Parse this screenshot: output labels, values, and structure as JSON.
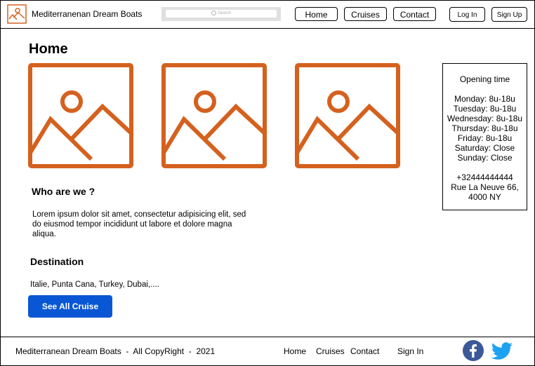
{
  "brand": {
    "name": "Mediterranenan Dream Boats"
  },
  "search": {
    "placeholder": "Search"
  },
  "nav": {
    "home": "Home",
    "cruises": "Cruises",
    "contact": "Contact"
  },
  "auth": {
    "login": "Log In",
    "signup": "Sign Up"
  },
  "page": {
    "title": "Home"
  },
  "about": {
    "heading": "Who are we ?",
    "text": "Lorem ipsum dolor sit amet, consectetur adipisicing elit, sed do eiusmod tempor incididunt ut labore et dolore magna aliqua."
  },
  "destination": {
    "heading": "Destination",
    "text": "Italie, Punta Cana, Turkey, Dubai,....",
    "button": "See All Cruise"
  },
  "hours": {
    "title": "Opening time",
    "lines": [
      "Monday: 8u-18u",
      "Tuesday: 8u-18u",
      "Wednesday: 8u-18u",
      "Thursday: 8u-18u",
      "Friday: 8u-18u",
      "Saturday: Close",
      "Sunday: Close"
    ],
    "phone": "+32444444444",
    "address1": "Rue La Neuve 66,",
    "address2": "4000 NY"
  },
  "footer": {
    "copyright": "Mediterranean Dream Boats  -  All CopyRight  -  2021",
    "home": "Home",
    "cruises": "Cruises",
    "contact": "Contact",
    "signin": "Sign In"
  },
  "colors": {
    "accent": "#d4611e",
    "button": "#0957d4",
    "facebook": "#3b5998",
    "twitter": "#1da1f2"
  },
  "icons": {
    "logo": "image-icon",
    "facebook": "facebook-icon",
    "twitter": "twitter-icon"
  }
}
